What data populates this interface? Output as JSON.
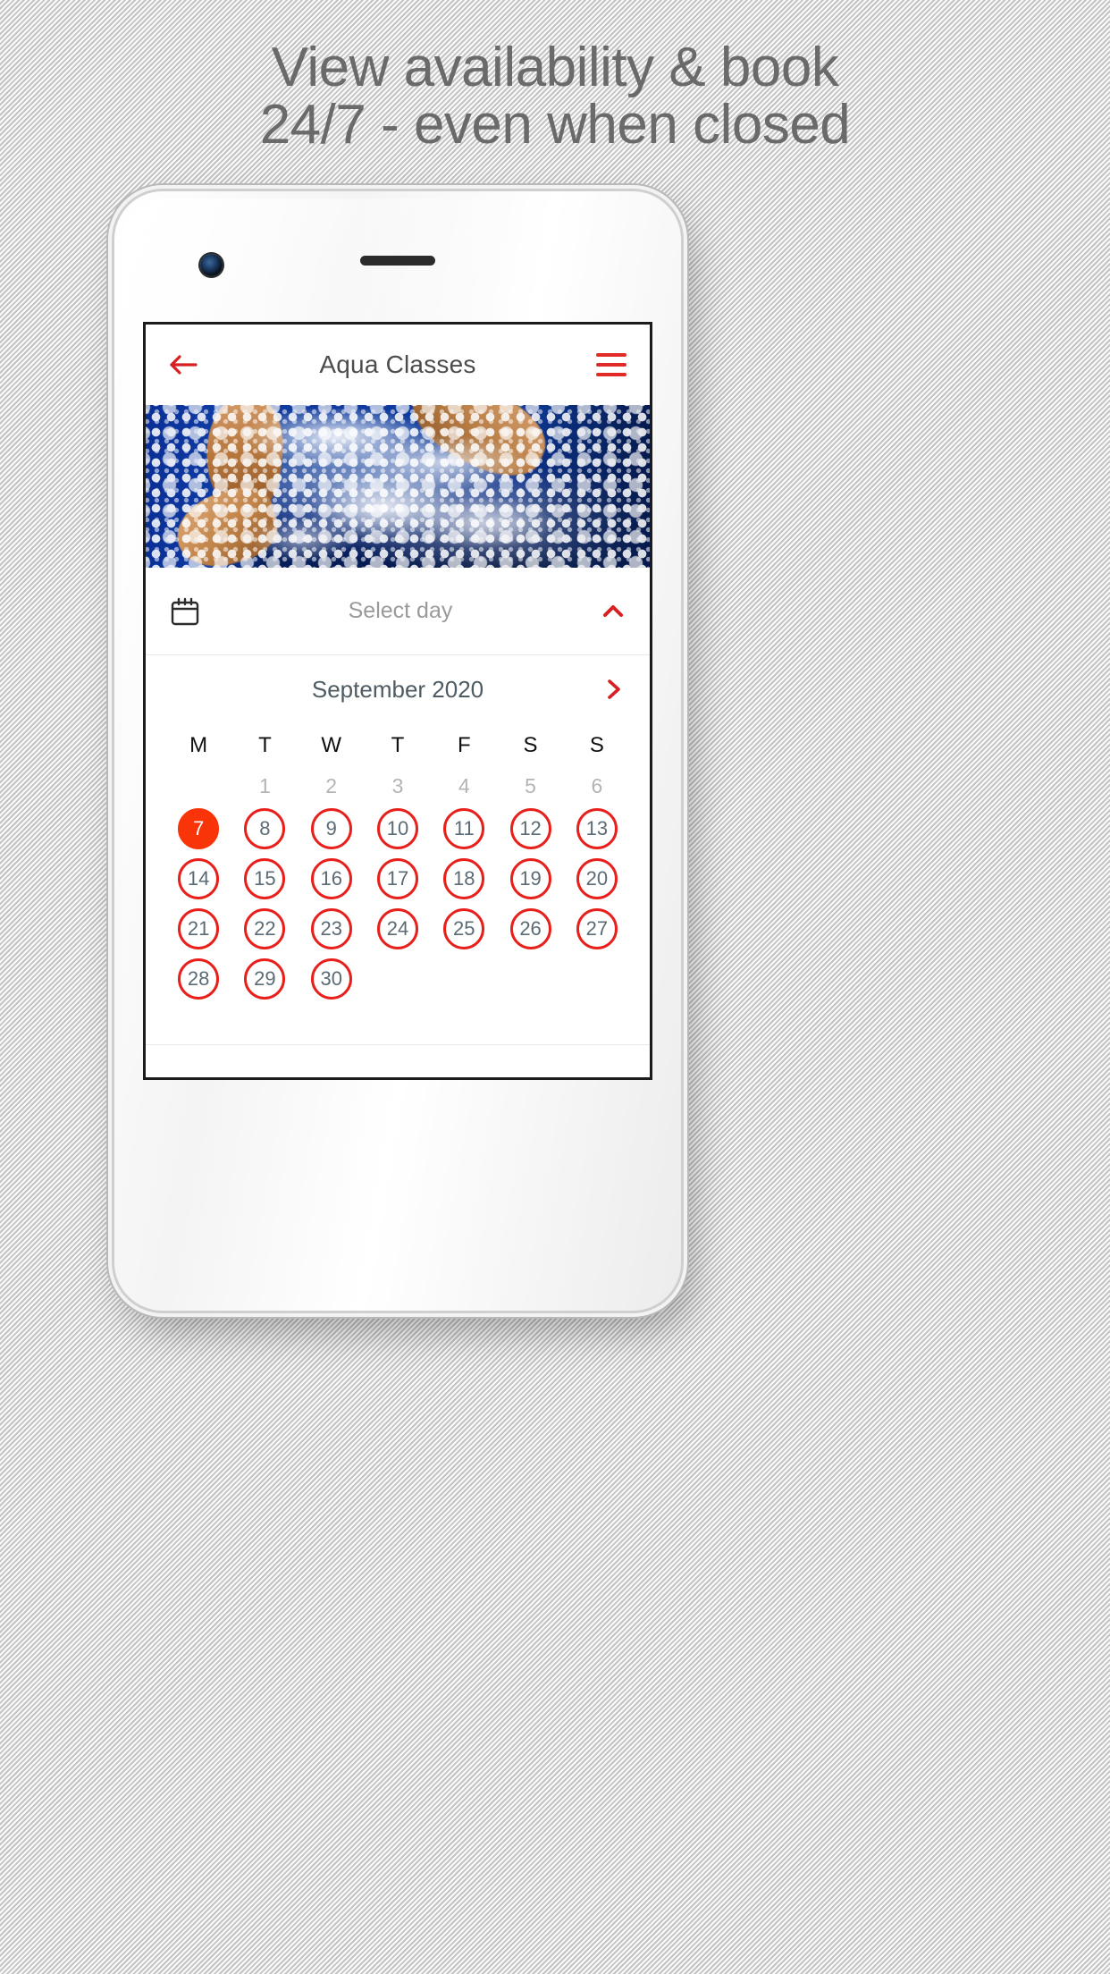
{
  "promo": {
    "headline_line1": "View availability & book",
    "headline_line2": "24/7 - even when closed",
    "headline_color": "#6a6a6a"
  },
  "theme": {
    "accent_red": "#e02b27",
    "ring_red": "#e8201c",
    "selected_orange": "#fa3409",
    "title_gray": "#4c4c4c",
    "muted_gray": "#b4b4b4"
  },
  "appbar": {
    "back_icon": "arrow-left-icon",
    "title": "Aqua Classes",
    "menu_icon": "hamburger-menu-icon"
  },
  "hero": {
    "alt": "swimmer splashing in deep blue pool water"
  },
  "select_day": {
    "calendar_icon": "calendar-icon",
    "label": "Select day",
    "chevron_icon": "chevron-up-icon",
    "expanded": true
  },
  "calendar": {
    "month_label": "September 2020",
    "next_icon": "chevron-right-icon",
    "weekdays": [
      "M",
      "T",
      "W",
      "T",
      "F",
      "S",
      "S"
    ],
    "leading_blanks": 1,
    "muted_days": [
      1,
      2,
      3,
      4,
      5,
      6
    ],
    "selected_day": 7,
    "available_days": [
      7,
      8,
      9,
      10,
      11,
      12,
      13,
      14,
      15,
      16,
      17,
      18,
      19,
      20,
      21,
      22,
      23,
      24,
      25,
      26,
      27,
      28,
      29,
      30
    ],
    "weeks": [
      [
        null,
        1,
        2,
        3,
        4,
        5,
        6
      ],
      [
        7,
        8,
        9,
        10,
        11,
        12,
        13
      ],
      [
        14,
        15,
        16,
        17,
        18,
        19,
        20
      ],
      [
        21,
        22,
        23,
        24,
        25,
        26,
        27
      ],
      [
        28,
        29,
        30,
        null,
        null,
        null,
        null
      ]
    ]
  }
}
